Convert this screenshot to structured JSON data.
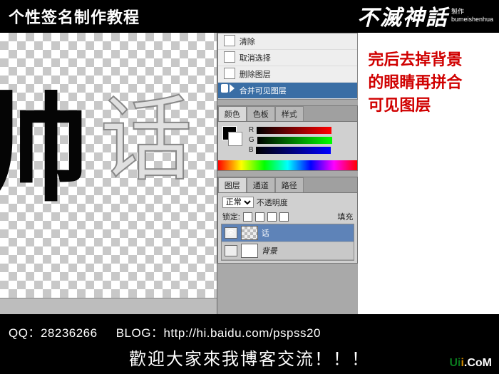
{
  "top": {
    "title": "个性签名制作教程",
    "brand_main": "不滅神話",
    "brand_sub1": "製作",
    "brand_sub2": "bumeishenhua"
  },
  "canvas": {
    "glyph1": "帅",
    "glyph2": "话"
  },
  "context_menu": {
    "items": [
      "清除",
      "取消选择",
      "删除图层"
    ],
    "selected": "合并可见图层"
  },
  "color_panel": {
    "tabs": [
      "颜色",
      "色板",
      "样式"
    ],
    "channels": [
      "R",
      "G",
      "B"
    ]
  },
  "layers_panel": {
    "tabs": [
      "图层",
      "通道",
      "路径"
    ],
    "blend_label": "正常",
    "opacity_label": "不透明度",
    "lock_label": "锁定:",
    "fill_label": "填充",
    "layers": [
      {
        "name": "话",
        "selected": true,
        "visible": true
      },
      {
        "name": "背景",
        "selected": false,
        "visible": false
      }
    ]
  },
  "instruction": {
    "line1": "完后去掉背景",
    "line2": "的眼睛再拼合",
    "line3": "可见图层"
  },
  "bottom": {
    "qq_label": "QQ：",
    "qq_value": "28236266",
    "blog_label": "BLOG：",
    "blog_value": "http://hi.baidu.com/pspss20",
    "welcome": "歡迎大家來我博客交流！！！",
    "wm_u": "Ui",
    "wm_i": "i",
    "wm_rest": ".CoM"
  }
}
